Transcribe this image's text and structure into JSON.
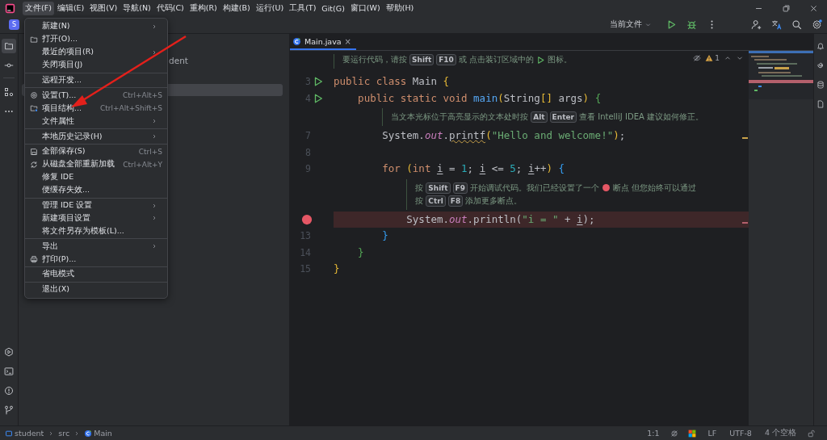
{
  "window": {
    "menubar": [
      {
        "label": "文件(F)",
        "selected": true
      },
      {
        "label": "编辑(E)",
        "selected": false
      },
      {
        "label": "视图(V)",
        "selected": false
      },
      {
        "label": "导航(N)",
        "selected": false
      },
      {
        "label": "代码(C)",
        "selected": false
      },
      {
        "label": "重构(R)",
        "selected": false
      },
      {
        "label": "构建(B)",
        "selected": false
      },
      {
        "label": "运行(U)",
        "selected": false
      },
      {
        "label": "工具(T)",
        "selected": false
      },
      {
        "label": "Git(G)",
        "selected": false
      },
      {
        "label": "窗口(W)",
        "selected": false
      },
      {
        "label": "帮助(H)",
        "selected": false
      }
    ]
  },
  "toolbar": {
    "project_initial": "S",
    "run_config": "当前文件"
  },
  "project_panel": {
    "tree": [
      {
        "label": "dent",
        "selected": false
      },
      {
        "selected": true
      }
    ]
  },
  "file_menu": {
    "items": [
      {
        "kind": "plain",
        "label": "新建(N)",
        "submenu": true
      },
      {
        "kind": "folder",
        "label": "打开(O)...",
        "submenu": false
      },
      {
        "kind": "plain",
        "label": "最近的项目(R)",
        "submenu": true
      },
      {
        "kind": "plain",
        "label": "关闭项目(J)",
        "submenu": false
      },
      {
        "kind": "separator"
      },
      {
        "kind": "plain",
        "label": "远程开发...",
        "submenu": false
      },
      {
        "kind": "separator"
      },
      {
        "kind": "settings",
        "label": "设置(T)...",
        "shortcut": "Ctrl+Alt+S",
        "submenu": false
      },
      {
        "kind": "structure",
        "label": "项目结构...",
        "shortcut": "Ctrl+Alt+Shift+S",
        "submenu": false
      },
      {
        "kind": "plain",
        "label": "文件属性",
        "submenu": true
      },
      {
        "kind": "separator"
      },
      {
        "kind": "plain",
        "label": "本地历史记录(H)",
        "submenu": true
      },
      {
        "kind": "separator"
      },
      {
        "kind": "save",
        "label": "全部保存(S)",
        "shortcut": "Ctrl+S",
        "submenu": false
      },
      {
        "kind": "reload",
        "label": "从磁盘全部重新加载",
        "shortcut": "Ctrl+Alt+Y",
        "submenu": false
      },
      {
        "kind": "plain",
        "label": "修复 IDE",
        "submenu": false
      },
      {
        "kind": "plain",
        "label": "便缓存失效...",
        "submenu": false
      },
      {
        "kind": "separator"
      },
      {
        "kind": "plain",
        "label": "管理 IDE 设置",
        "submenu": true
      },
      {
        "kind": "plain",
        "label": "新建项目设置",
        "submenu": true
      },
      {
        "kind": "plain",
        "label": "将文件另存为模板(L)...",
        "submenu": false
      },
      {
        "kind": "separator"
      },
      {
        "kind": "plain",
        "label": "导出",
        "submenu": true
      },
      {
        "kind": "print",
        "label": "打印(P)...",
        "submenu": false
      },
      {
        "kind": "separator"
      },
      {
        "kind": "plain",
        "label": "省电模式",
        "submenu": false
      },
      {
        "kind": "separator"
      },
      {
        "kind": "plain",
        "label": "退出(X)",
        "submenu": false
      }
    ]
  },
  "editor": {
    "tab": {
      "label": "Main.java",
      "close": "×",
      "selected": true
    },
    "inspections": {
      "warnings": "1"
    },
    "lines": [
      {
        "kind": "hint",
        "rows": [
          [
            {
              "kind": "text",
              "text": "要运行代码，请按"
            },
            {
              "kind": "key",
              "text": "Shift"
            },
            {
              "kind": "key",
              "text": "F10"
            },
            {
              "kind": "text",
              "text": "或 点击装订区域中的"
            },
            {
              "kind": "run"
            },
            {
              "kind": "text",
              "text": "图标。"
            }
          ]
        ]
      },
      {
        "kind": "code",
        "number": "3",
        "runnable": true,
        "breakpoint": false,
        "warning": false,
        "tokens": [
          {
            "kind": "kw",
            "text": "public class "
          },
          {
            "kind": "plain",
            "text": "Main "
          },
          {
            "kind": "b1",
            "text": "{"
          }
        ]
      },
      {
        "kind": "code",
        "number": "4",
        "runnable": true,
        "breakpoint": false,
        "warning": false,
        "tokens": [
          {
            "kind": "kw",
            "text": "    public static void "
          },
          {
            "kind": "method",
            "text": "main"
          },
          {
            "kind": "b1",
            "text": "("
          },
          {
            "kind": "plain",
            "text": "String"
          },
          {
            "kind": "b1",
            "text": "[]"
          },
          {
            "kind": "plain",
            "text": " args"
          },
          {
            "kind": "b1",
            "text": ") "
          },
          {
            "kind": "b2",
            "text": "{"
          }
        ]
      },
      {
        "kind": "hint",
        "rows": [
          [
            {
              "kind": "text",
              "text": "当文本光标位于高亮显示的文本处时按"
            },
            {
              "kind": "key",
              "text": "Alt"
            },
            {
              "kind": "key",
              "text": "Enter"
            },
            {
              "kind": "text",
              "text": "查看 IntelliJ IDEA 建议如何修正。"
            }
          ]
        ]
      },
      {
        "kind": "code",
        "number": "7",
        "runnable": false,
        "breakpoint": false,
        "warning": true,
        "tokens": [
          {
            "kind": "plain",
            "text": "        System."
          },
          {
            "kind": "field",
            "text": "out"
          },
          {
            "kind": "plain",
            "text": "."
          },
          {
            "kind": "warn",
            "text": "printf"
          },
          {
            "kind": "b1",
            "text": "("
          },
          {
            "kind": "string",
            "text": "\"Hello and welcome!\""
          },
          {
            "kind": "b1",
            "text": ")"
          },
          {
            "kind": "plain",
            "text": ";"
          }
        ]
      },
      {
        "kind": "code",
        "number": "8",
        "runnable": false,
        "breakpoint": false,
        "warning": false
      },
      {
        "kind": "code",
        "number": "9",
        "runnable": false,
        "breakpoint": false,
        "warning": false,
        "tokens": [
          {
            "kind": "kw",
            "text": "        for "
          },
          {
            "kind": "b1",
            "text": "("
          },
          {
            "kind": "kw",
            "text": "int "
          },
          {
            "kind": "var",
            "text": "i"
          },
          {
            "kind": "plain",
            "text": " = "
          },
          {
            "kind": "num",
            "text": "1"
          },
          {
            "kind": "plain",
            "text": "; "
          },
          {
            "kind": "var",
            "text": "i"
          },
          {
            "kind": "plain",
            "text": " <= "
          },
          {
            "kind": "num",
            "text": "5"
          },
          {
            "kind": "plain",
            "text": "; "
          },
          {
            "kind": "var",
            "text": "i"
          },
          {
            "kind": "plain",
            "text": "++"
          },
          {
            "kind": "b1",
            "text": ") "
          },
          {
            "kind": "b3",
            "text": "{"
          }
        ]
      },
      {
        "kind": "hint",
        "rows": [
          [
            {
              "kind": "text",
              "text": "按"
            },
            {
              "kind": "key",
              "text": "Shift"
            },
            {
              "kind": "key",
              "text": "F9"
            },
            {
              "kind": "text",
              "text": "开始调试代码。我们已经设置了一个"
            },
            {
              "kind": "breakpoint"
            },
            {
              "kind": "text",
              "text": "断点 但您始终可以通过"
            }
          ],
          [
            {
              "kind": "text",
              "text": "按"
            },
            {
              "kind": "key",
              "text": "Ctrl"
            },
            {
              "kind": "key",
              "text": "F8"
            },
            {
              "kind": "text",
              "text": "添加更多断点。"
            }
          ]
        ]
      },
      {
        "kind": "code",
        "runnable": false,
        "breakpoint": true,
        "warning": false,
        "tokens": [
          {
            "kind": "plain",
            "text": "            System."
          },
          {
            "kind": "field",
            "text": "out"
          },
          {
            "kind": "plain",
            "text": ".println("
          },
          {
            "kind": "string",
            "text": "\"i = \""
          },
          {
            "kind": "plain",
            "text": " + "
          },
          {
            "kind": "var",
            "text": "i"
          },
          {
            "kind": "plain",
            "text": ");"
          }
        ]
      },
      {
        "kind": "code",
        "number": "13",
        "runnable": false,
        "breakpoint": false,
        "warning": false,
        "tokens": [
          {
            "kind": "b3",
            "text": "        }"
          }
        ]
      },
      {
        "kind": "code",
        "number": "14",
        "runnable": false,
        "breakpoint": false,
        "warning": false,
        "tokens": [
          {
            "kind": "b2",
            "text": "    }"
          }
        ]
      },
      {
        "kind": "code",
        "number": "15",
        "runnable": false,
        "breakpoint": false,
        "warning": false,
        "tokens": [
          {
            "kind": "b1",
            "text": "}"
          }
        ]
      }
    ]
  },
  "status_bar": {
    "breadcrumbs": [
      {
        "kind": "module",
        "label": "student"
      },
      {
        "kind": "folder",
        "label": "src"
      },
      {
        "kind": "class",
        "label": "Main"
      }
    ],
    "position": "1:1",
    "line_separator": "LF",
    "encoding": "UTF-8",
    "indent": "4 个空格"
  }
}
